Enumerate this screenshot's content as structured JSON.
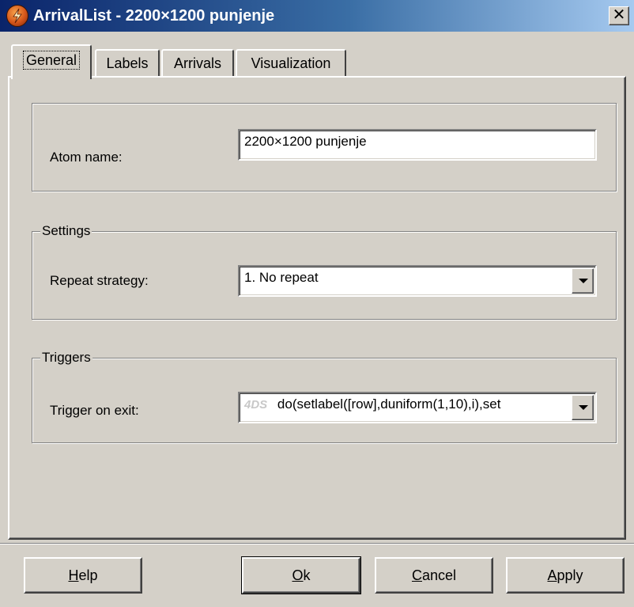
{
  "window": {
    "title": "ArrivalList - 2200×1200 punjenje",
    "close_glyph": "✕",
    "icon": "flexsim-app-icon"
  },
  "tabs": [
    {
      "label": "General",
      "active": true
    },
    {
      "label": "Labels",
      "active": false
    },
    {
      "label": "Arrivals",
      "active": false
    },
    {
      "label": "Visualization",
      "active": false
    }
  ],
  "general": {
    "atom_name_label": "Atom name:",
    "atom_name_value": "2200×1200 punjenje",
    "settings_legend": "Settings",
    "repeat_strategy_label": "Repeat strategy:",
    "repeat_strategy_value": "1. No repeat",
    "triggers_legend": "Triggers",
    "trigger_on_exit_label": "Trigger on exit:",
    "trigger_badge": "4DS",
    "trigger_on_exit_value": "do(setlabel([row],duniform(1,10),i),set"
  },
  "buttons": {
    "help": {
      "label": "Help",
      "mnemonic": "H",
      "rest": "elp"
    },
    "ok": {
      "label": "Ok",
      "mnemonic": "O",
      "rest": "k"
    },
    "cancel": {
      "label": "Cancel",
      "mnemonic": "C",
      "rest": "ancel"
    },
    "apply": {
      "label": "Apply",
      "mnemonic": "A",
      "rest": "pply"
    }
  },
  "colors": {
    "face": "#d4d0c8",
    "title_start": "#0a246a",
    "title_end": "#a6caf0"
  }
}
